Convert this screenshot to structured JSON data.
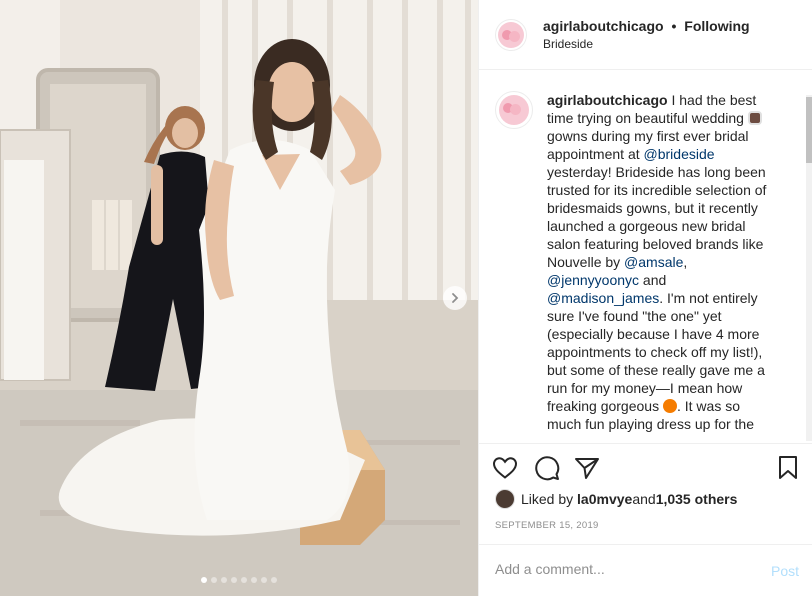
{
  "post": {
    "username": "agirlaboutchicago",
    "separator": "•",
    "follow_status": "Following",
    "location": "Brideside"
  },
  "caption": {
    "username": "agirlaboutchicago",
    "part1": " I had the best time trying on beautiful wedding ",
    "part2": " gowns during my first ever bridal appointment at ",
    "mention1": "@brideside",
    "part3": " yesterday! Brideside has long been trusted for its incredible selection of bridesmaids gowns, but it recently launched a gorgeous new bridal salon featuring beloved brands like Nouvelle by ",
    "mention2": "@amsale",
    "part4": ", ",
    "mention3": "@jennyyoonyc",
    "part5": " and ",
    "mention4": "@madison_james",
    "part6": ". I'm not entirely sure I've found \"the one\" yet (especially because I have 4 more appointments to check off my list!), but some of these really gave me a run for my money—I mean how freaking gorgeous ",
    "part7": ". It was so much fun playing dress up for the",
    "emoji1": "bride-emoji",
    "emoji2": "fox-emoji"
  },
  "likes": {
    "prefix": "Liked by ",
    "user": "la0mvye",
    "middle": " and ",
    "count": "1,035 others"
  },
  "date": "SEPTEMBER 15, 2019",
  "comment": {
    "placeholder": "Add a comment...",
    "post_label": "Post"
  },
  "carousel": {
    "slide_count": 8,
    "active_index": 0
  },
  "icons": {
    "like": "heart-icon",
    "comment": "comment-icon",
    "share": "send-icon",
    "save": "bookmark-icon",
    "next": "chevron-right-icon"
  },
  "colors": {
    "mention": "#00376b",
    "post_button": "#b2dffc",
    "muted": "#8e8e8e",
    "border": "#efefef"
  }
}
